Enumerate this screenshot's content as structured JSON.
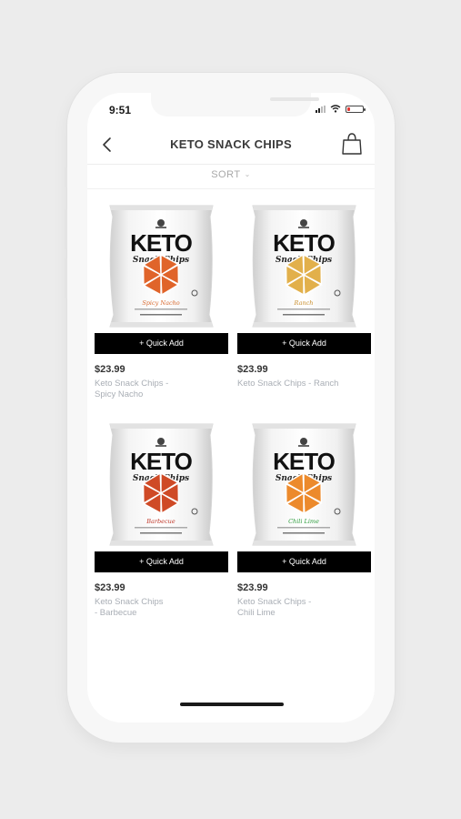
{
  "status_bar": {
    "time": "9:51"
  },
  "header": {
    "title": "KETO SNACK CHIPS"
  },
  "sort": {
    "label": "SORT"
  },
  "colors": {
    "quick_add_bg": "#000000",
    "name_text": "#a9aeb5",
    "battery_low": "#e53935"
  },
  "products": [
    {
      "quick_add": "+ Quick Add",
      "price": "$23.99",
      "name_lines": [
        "Keto Snack Chips -",
        "Spicy Nacho"
      ],
      "chip_color": "#e0642a",
      "flavor_color": "#d9692e",
      "bag_brand": "KETO",
      "bag_sub": "Snack Chips",
      "bag_flavor": "Spicy Nacho"
    },
    {
      "quick_add": "+ Quick Add",
      "price": "$23.99",
      "name_lines": [
        "Keto Snack Chips - Ranch"
      ],
      "chip_color": "#e2b04b",
      "flavor_color": "#c98f2d",
      "bag_brand": "KETO",
      "bag_sub": "Snack Chips",
      "bag_flavor": "Ranch"
    },
    {
      "quick_add": "+ Quick Add",
      "price": "$23.99",
      "name_lines": [
        "Keto Snack Chips",
        "- Barbecue"
      ],
      "chip_color": "#cf4a26",
      "flavor_color": "#c0392b",
      "bag_brand": "KETO",
      "bag_sub": "Snack Chips",
      "bag_flavor": "Barbecue"
    },
    {
      "quick_add": "+ Quick Add",
      "price": "$23.99",
      "name_lines": [
        "Keto Snack Chips -",
        "Chili Lime"
      ],
      "chip_color": "#ec8a2c",
      "flavor_color": "#2e9e3e",
      "bag_brand": "KETO",
      "bag_sub": "Snack Chips",
      "bag_flavor": "Chili Lime"
    }
  ]
}
